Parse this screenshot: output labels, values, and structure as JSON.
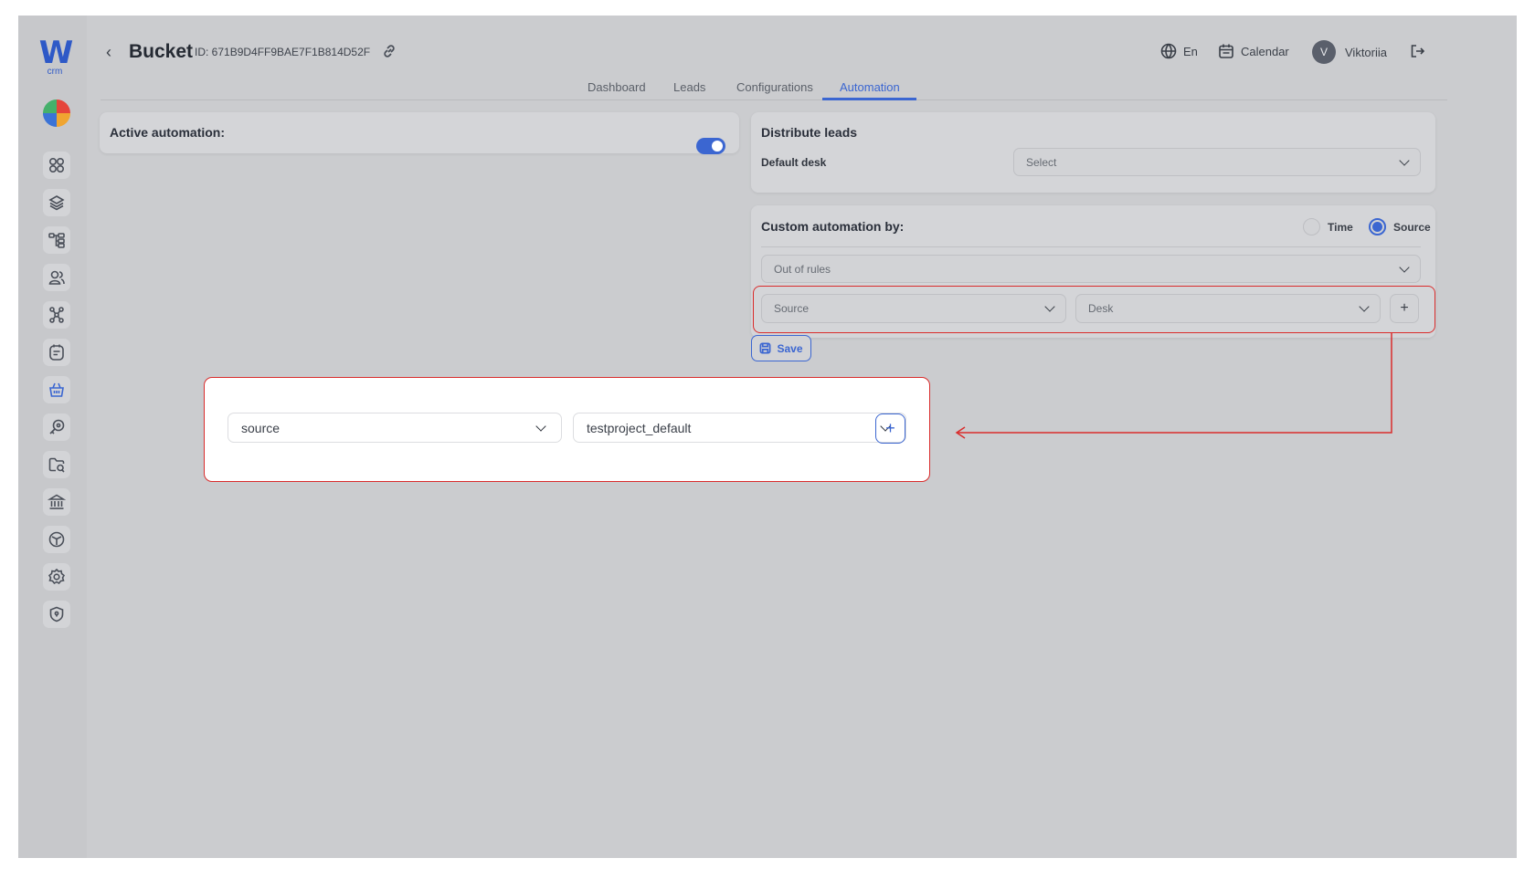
{
  "header": {
    "title": "Bucket",
    "bucket_id": "ID: 671B9D4FF9BAE7F1B814D52F",
    "language": "En",
    "calendar": "Calendar",
    "user_initial": "V",
    "user_name": "Viktoriia"
  },
  "tabs": [
    {
      "label": "Dashboard"
    },
    {
      "label": "Leads"
    },
    {
      "label": "Configurations"
    },
    {
      "label": "Automation"
    }
  ],
  "active_tab": "Automation",
  "active_automation": {
    "label": "Active automation:",
    "enabled": true
  },
  "distribute_leads": {
    "title": "Distribute leads",
    "default_desk_label": "Default desk",
    "default_desk_placeholder": "Select"
  },
  "custom_automation": {
    "title": "Custom automation by:",
    "options": [
      {
        "label": "Time",
        "checked": false
      },
      {
        "label": "Source",
        "checked": true
      }
    ],
    "out_of_rules": "Out of rules",
    "rule_source_placeholder": "Source",
    "rule_desk_placeholder": "Desk",
    "add_symbol": "+"
  },
  "save_label": "Save",
  "zoom": {
    "source_value": "source",
    "desk_value": "testproject_default",
    "add_symbol": "+"
  },
  "sidebar_icons": [
    "grid-icon",
    "layers-icon",
    "hierarchy-icon",
    "users-icon",
    "network-icon",
    "notes-icon",
    "basket-icon",
    "key-search-icon",
    "folder-icon",
    "bank-icon",
    "cube-icon",
    "gear-icon",
    "shield-icon"
  ],
  "colors": {
    "accent": "#3b66d1",
    "highlight": "#d92c2c",
    "overlay": "#cbcccf"
  }
}
